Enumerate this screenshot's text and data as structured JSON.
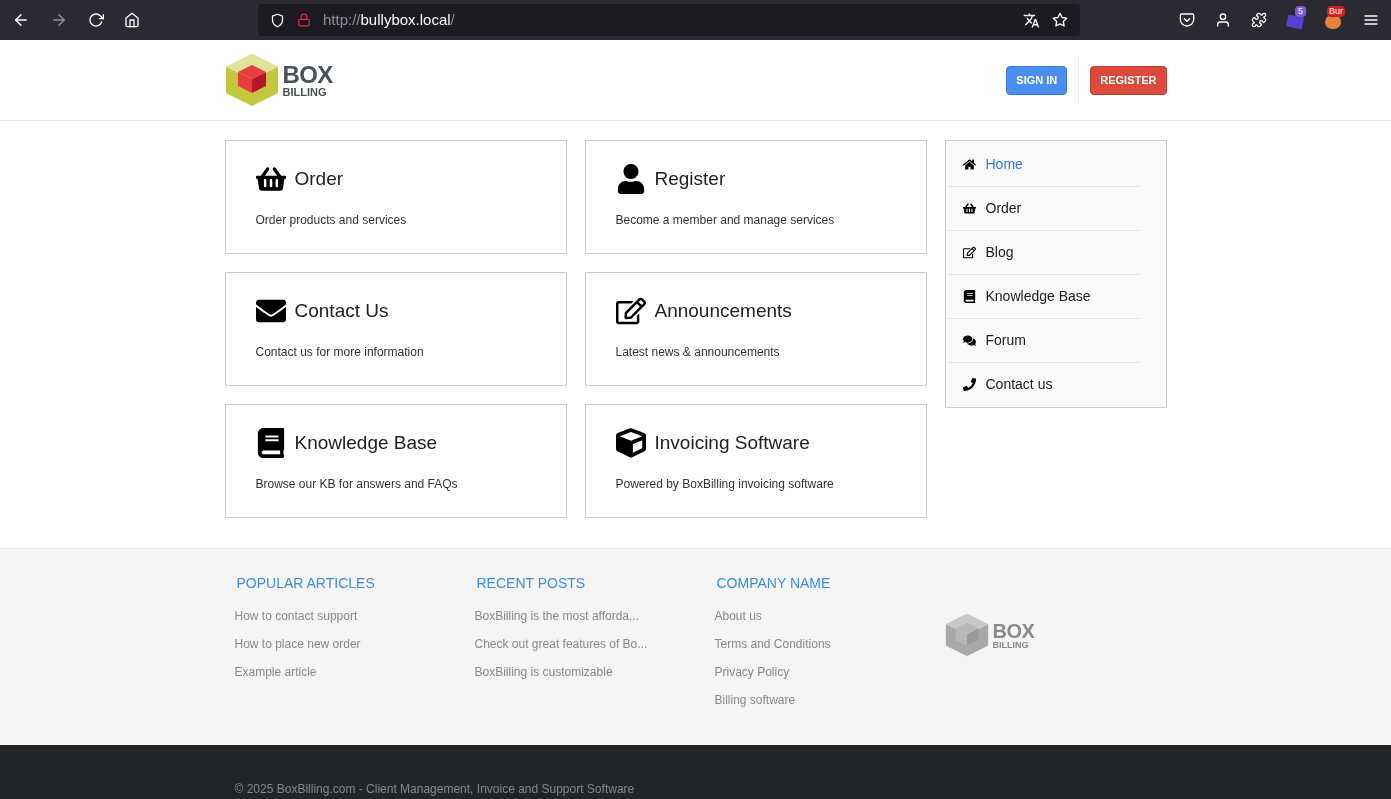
{
  "browser": {
    "url_scheme": "http://",
    "url_host": "bullybox.local",
    "url_path": "/",
    "extension_badge": "5",
    "extension_label": "Bur"
  },
  "header": {
    "logo": {
      "line1": "BOX",
      "line2": "BILLING"
    },
    "buttons": [
      {
        "label": "SIGN IN",
        "kind": "primary"
      },
      {
        "label": "REGISTER",
        "kind": "danger"
      }
    ]
  },
  "cards": [
    {
      "kind": "basket",
      "title": "Order",
      "text": "Order products and services"
    },
    {
      "kind": "user",
      "title": "Register",
      "text": "Become a member and manage services"
    },
    {
      "kind": "envelope",
      "title": "Contact Us",
      "text": "Contact us for more information"
    },
    {
      "kind": "edit",
      "title": "Announcements",
      "text": "Latest news & announcements"
    },
    {
      "kind": "book",
      "title": "Knowledge Base",
      "text": "Browse our KB for answers and FAQs"
    },
    {
      "kind": "cube",
      "title": "Invoicing Software",
      "text": "Powered by BoxBilling invoicing software"
    }
  ],
  "sidebar": {
    "items": [
      {
        "kind": "home",
        "label": "Home",
        "selected": true
      },
      {
        "kind": "basket",
        "label": "Order",
        "selected": false
      },
      {
        "kind": "edit",
        "label": "Blog",
        "selected": false
      },
      {
        "kind": "book",
        "label": "Knowledge Base",
        "selected": false
      },
      {
        "kind": "comments",
        "label": "Forum",
        "selected": false
      },
      {
        "kind": "phone",
        "label": "Contact us",
        "selected": false
      }
    ]
  },
  "footer": {
    "columns": [
      {
        "title": "POPULAR ARTICLES",
        "links": [
          "How to contact support",
          "How to place new order",
          "Example article"
        ]
      },
      {
        "title": "RECENT POSTS",
        "links": [
          "BoxBilling is the most afforda...",
          "Check out great features of Bo...",
          "BoxBilling is customizable"
        ]
      },
      {
        "title": "COMPANY NAME",
        "links": [
          "About us",
          "Terms and Conditions",
          "Privacy Policy",
          "Billing software"
        ]
      }
    ],
    "logo": {
      "line1": "BOX",
      "line2": "BILLING"
    },
    "copyright": "© 2025 BoxBilling.com - Client Management, Invoice and Support Software"
  }
}
